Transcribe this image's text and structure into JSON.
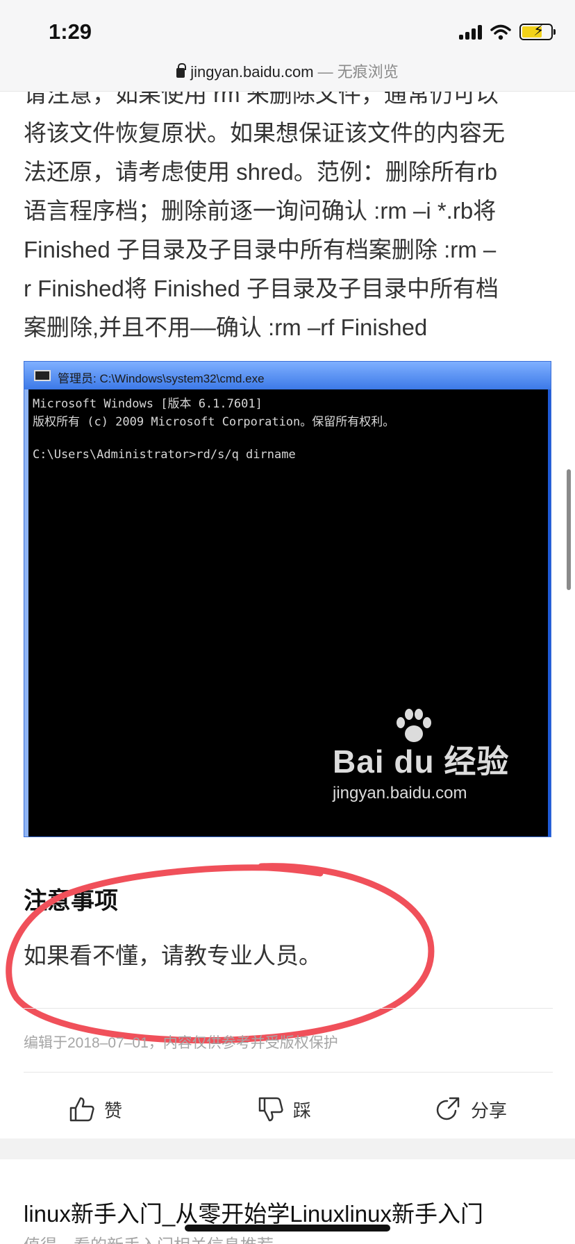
{
  "status_bar": {
    "time": "1:29"
  },
  "browser": {
    "domain": "jingyan.baidu.com",
    "mode_suffix": " — 无痕浏览"
  },
  "article": {
    "lines": [
      "请注意，如果使用 rm 来删除文件，通常仍可以",
      "将该文件恢复原状。如果想保证该文件的内容无",
      "法还原，请考虑使用 shred。范例：删除所有rb",
      "语言程序档；删除前逐一询问确认 :rm –i *.rb将",
      "Finished 子目录及子目录中所有档案删除 :rm –",
      "r Finished将 Finished 子目录及子目录中所有档",
      "案删除,并且不用––确认 :rm –rf Finished"
    ]
  },
  "cmd_image": {
    "window_title": "管理员: C:\\Windows\\system32\\cmd.exe",
    "console_lines": [
      "Microsoft Windows [版本 6.1.7601]",
      "版权所有 (c) 2009 Microsoft Corporation。保留所有权利。",
      "",
      "C:\\Users\\Administrator>rd/s/q dirname"
    ],
    "watermark_brand": "Bai du 经验",
    "watermark_url": "jingyan.baidu.com"
  },
  "notes": {
    "title": "注意事项",
    "body": "如果看不懂，请教专业人员。"
  },
  "meta": {
    "edited": "编辑于2018–07–01，内容仅供参考并受版权保护"
  },
  "actions": {
    "like_label": "赞",
    "dislike_label": "踩",
    "share_label": "分享"
  },
  "recommendation": {
    "title": "linux新手入门_从零开始学Linuxlinux新手入门",
    "subtitle": "值得一看的新手入门相关信息推荐"
  },
  "colors": {
    "annotation_circle": "#f0505a",
    "cmd_frame": "#1e5ad6"
  },
  "icons": [
    "lock-icon",
    "signal-icon",
    "wifi-icon",
    "battery-icon",
    "thumbs-up-icon",
    "thumbs-down-icon",
    "share-icon",
    "paw-icon"
  ]
}
